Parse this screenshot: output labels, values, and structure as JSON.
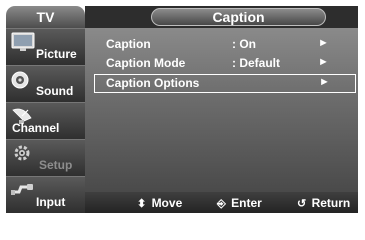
{
  "sidebar": {
    "title": "TV",
    "items": [
      {
        "label": "Picture",
        "icon": "picture-icon"
      },
      {
        "label": "Sound",
        "icon": "sound-icon"
      },
      {
        "label": "Channel",
        "icon": "channel-icon"
      },
      {
        "label": "Setup",
        "icon": "setup-icon",
        "dimmed": true
      },
      {
        "label": "Input",
        "icon": "input-icon"
      }
    ]
  },
  "header": {
    "title": "Caption"
  },
  "menu": {
    "rows": [
      {
        "label": "Caption",
        "value": ": On",
        "arrow": "►"
      },
      {
        "label": "Caption Mode",
        "value": ": Default",
        "arrow": "►"
      },
      {
        "label": "Caption Options",
        "value": "",
        "arrow": "►",
        "highlighted": true
      }
    ]
  },
  "footer": {
    "move": {
      "icon": "⬍",
      "label": "Move"
    },
    "enter": {
      "icon": "⎆",
      "label": "Enter"
    },
    "return": {
      "icon": "↺",
      "label": "Return"
    }
  },
  "colors": {
    "menu_text": "#ffffff",
    "highlight_border": "#ffffff",
    "panel_dark": "#2d2d2d",
    "dimmed_text": "#8d8d8d"
  }
}
